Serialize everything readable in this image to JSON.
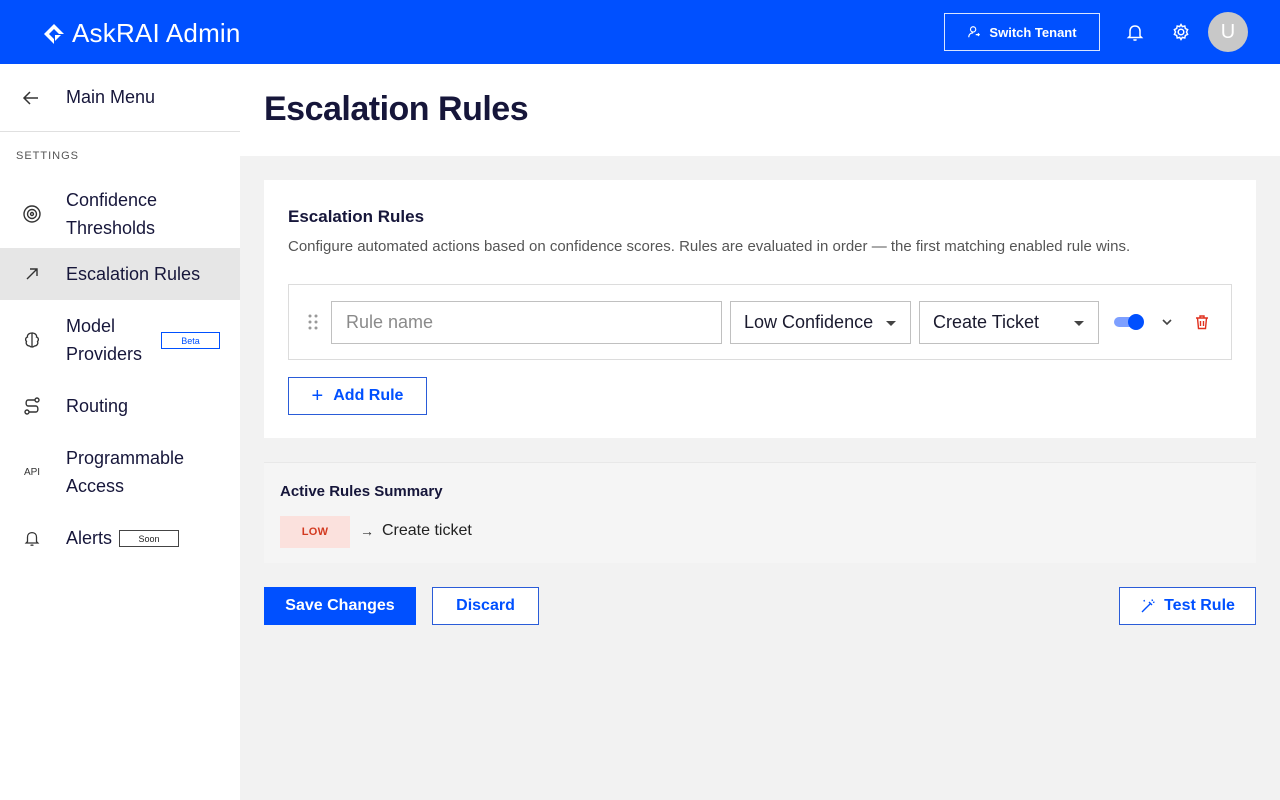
{
  "app": {
    "brand_name": "AskRAI Admin",
    "switch_tenant_label": "Switch Tenant",
    "avatar_initial": "U",
    "brand_color": "#0050ff"
  },
  "sidebar": {
    "main_menu_label": "Main Menu",
    "section_label": "SETTINGS",
    "items": [
      {
        "label_line1": "Confidence",
        "label_line2": "Thresholds",
        "icon": "target-icon"
      },
      {
        "label": "Escalation Rules",
        "icon": "arrow-up-right-icon",
        "active": true
      },
      {
        "label_line1": "Model",
        "label_line2": "Providers",
        "icon": "brain-icon",
        "badge": "Beta"
      },
      {
        "label": "Routing",
        "icon": "route-icon"
      },
      {
        "label_line1": "Programmable",
        "label_line2": "Access",
        "icon": "api-icon",
        "icon_text": "API"
      },
      {
        "label": "Alerts",
        "icon": "bell-icon",
        "badge": "Soon"
      }
    ]
  },
  "page": {
    "title": "Escalation Rules"
  },
  "rules_card": {
    "title": "Escalation Rules",
    "description": "Configure automated actions based on confidence scores. Rules are evaluated in order — the first matching enabled rule wins.",
    "rules": [
      {
        "name_value": "",
        "name_placeholder": "Rule name",
        "condition": "Low Confidence",
        "action": "Create Ticket",
        "enabled": true
      }
    ],
    "add_rule_label": "Add Rule"
  },
  "summary": {
    "title": "Active Rules Summary",
    "items": [
      {
        "severity": "LOW",
        "arrow": "→",
        "action": "Create ticket"
      }
    ]
  },
  "actions": {
    "save_label": "Save Changes",
    "discard_label": "Discard",
    "test_label": "Test Rule"
  }
}
